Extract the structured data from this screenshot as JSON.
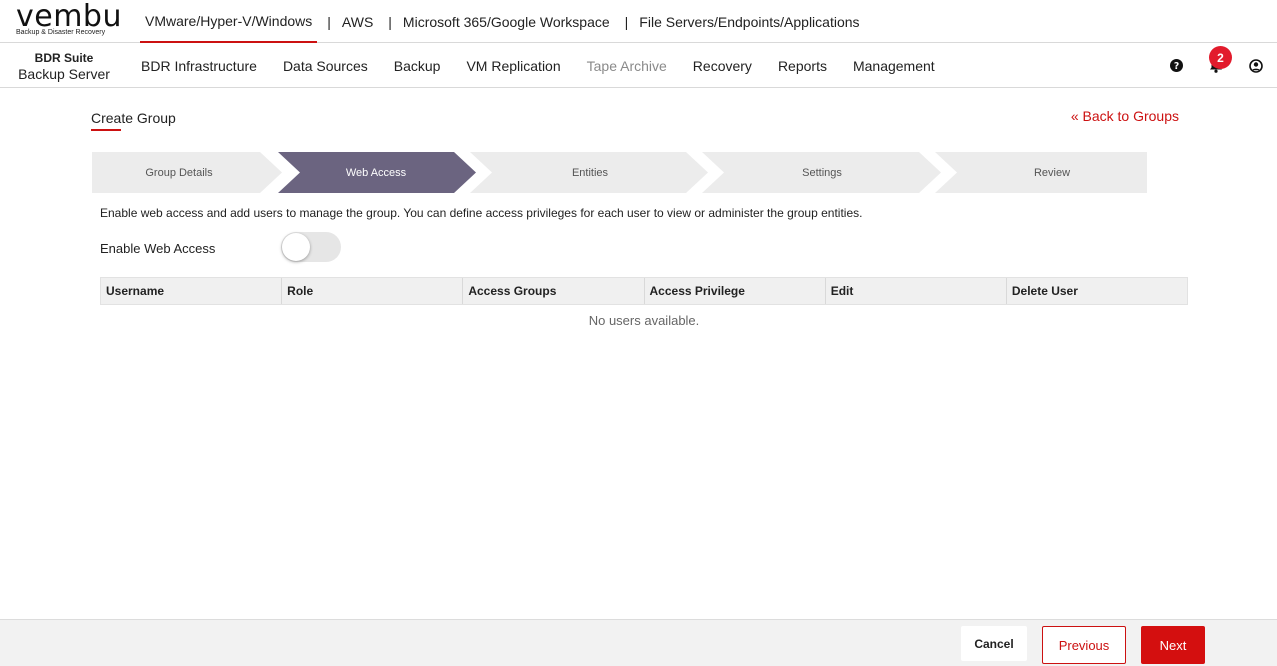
{
  "brand": {
    "logo_text": "vembu",
    "tagline": "Backup & Disaster Recovery"
  },
  "product_nav": {
    "items": [
      {
        "label": "VMware/Hyper-V/Windows",
        "active": true
      },
      {
        "label": "AWS",
        "active": false
      },
      {
        "label": "Microsoft 365/Google Workspace",
        "active": false
      },
      {
        "label": "File Servers/Endpoints/Applications",
        "active": false
      }
    ],
    "separator": "|"
  },
  "suite": {
    "line1": "BDR Suite",
    "line2": "Backup Server"
  },
  "main_menu": {
    "items": [
      {
        "label": "BDR Infrastructure",
        "disabled": false
      },
      {
        "label": "Data Sources",
        "disabled": false
      },
      {
        "label": "Backup",
        "disabled": false
      },
      {
        "label": "VM Replication",
        "disabled": false
      },
      {
        "label": "Tape Archive",
        "disabled": true
      },
      {
        "label": "Recovery",
        "disabled": false
      },
      {
        "label": "Reports",
        "disabled": false
      },
      {
        "label": "Management",
        "disabled": false
      }
    ]
  },
  "header_icons": {
    "help_icon": "question-circle-icon",
    "notifications_icon": "bell-icon",
    "notification_count": "2",
    "user_icon": "user-circle-icon"
  },
  "page": {
    "title": "Create Group",
    "back_link": "« Back to Groups"
  },
  "steps": [
    {
      "label": "Group Details",
      "active": false
    },
    {
      "label": "Web Access",
      "active": true
    },
    {
      "label": "Entities",
      "active": false
    },
    {
      "label": "Settings",
      "active": false
    },
    {
      "label": "Review",
      "active": false
    }
  ],
  "web_access": {
    "description": "Enable web access and add users to manage the group. You can define access privileges for each user to view or administer the group entities.",
    "toggle_label": "Enable Web Access",
    "enabled": false
  },
  "users_table": {
    "columns": [
      "Username",
      "Role",
      "Access Groups",
      "Access Privilege",
      "Edit",
      "Delete User"
    ],
    "empty_message": "No users available."
  },
  "footer": {
    "cancel_label": "Cancel",
    "previous_label": "Previous",
    "next_label": "Next"
  },
  "colors": {
    "accent": "#cc1111",
    "step_active": "#6b6480",
    "step_inactive": "#ececec"
  }
}
